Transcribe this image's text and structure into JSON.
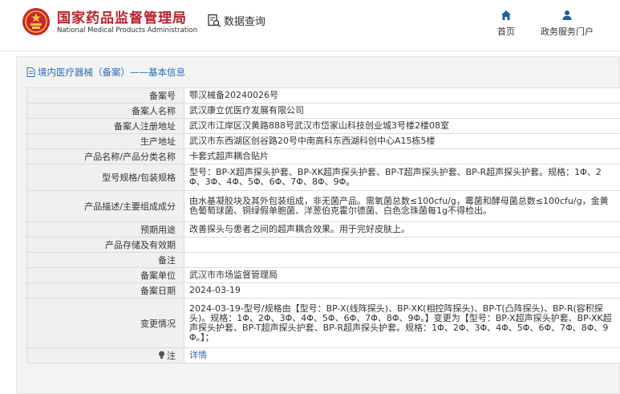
{
  "header": {
    "org_cn": "国家药品监督管理局",
    "org_en": "National Medical Products Administration",
    "data_query": "数据查询",
    "nav_home": "首页",
    "nav_gov": "政务服务门户"
  },
  "colors": {
    "brand_red": "#b8232d",
    "link_blue": "#2b6cb7"
  },
  "breadcrumb": {
    "text": "境内医疗器械（备案）——基本信息"
  },
  "table": {
    "rows": [
      {
        "label": "备案号",
        "value": "鄂汉械备20240026号"
      },
      {
        "label": "备案人名称",
        "value": "武汉康立优医疗发展有限公司"
      },
      {
        "label": "备案人注册地址",
        "value": "武汉市江岸区汉黄路888号武汉市岱家山科技创业城3号楼2楼08室"
      },
      {
        "label": "生产地址",
        "value": "武汉市东西湖区创谷路20号中南高科东西湖科创中心A15栋5楼"
      },
      {
        "label": "产品名称/产品分类名称",
        "value": "卡套式超声耦合贴片"
      },
      {
        "label": "型号规格/包装规格",
        "value": "型号：BP-X超声探头护套、BP-XK超声探头护套、BP-T超声探头护套、BP-R超声探头护套。规格：1Φ、2Φ、3Φ、4Φ、5Φ、6Φ、7Φ、8Φ、9Φ。"
      },
      {
        "label": "产品描述/主要组成成分",
        "value": "由水基凝胶块及其外包装组成，非无菌产品。需氧菌总数≤100cfu/g，霉菌和酵母菌总数≤100cfu/g，金黄色葡萄球菌、铜绿假单胞菌、洋葱伯克霍尔德菌、白色念珠菌每1g不得检出。"
      },
      {
        "label": "预期用途",
        "value": "改善探头与患者之间的超声耦合效果。用于完好皮肤上。"
      },
      {
        "label": "产品存储及有效期",
        "value": ""
      },
      {
        "label": "备注",
        "value": ""
      },
      {
        "label": "备案单位",
        "value": "武汉市市场监督管理局"
      },
      {
        "label": "备案日期",
        "value": "2024-03-19"
      },
      {
        "label": "变更情况",
        "value": "2024-03-19-型号/规格由【型号：BP-X(线阵探头)、BP-XK(相控阵探头)、BP-T(凸阵探头)、BP-R(容积探头)。规格：1Φ、2Φ、3Φ、4Φ、5Φ、6Φ、7Φ、8Φ、9Φ。】变更为【型号：BP-X超声探头护套、BP-XK超声探头护套、BP-T超声探头护套、BP-R超声探头护套。规格：1Φ、2Φ、3Φ、4Φ、5Φ、6Φ、7Φ、8Φ、9Φ。】；"
      },
      {
        "label": "注",
        "value": "详情"
      }
    ]
  }
}
